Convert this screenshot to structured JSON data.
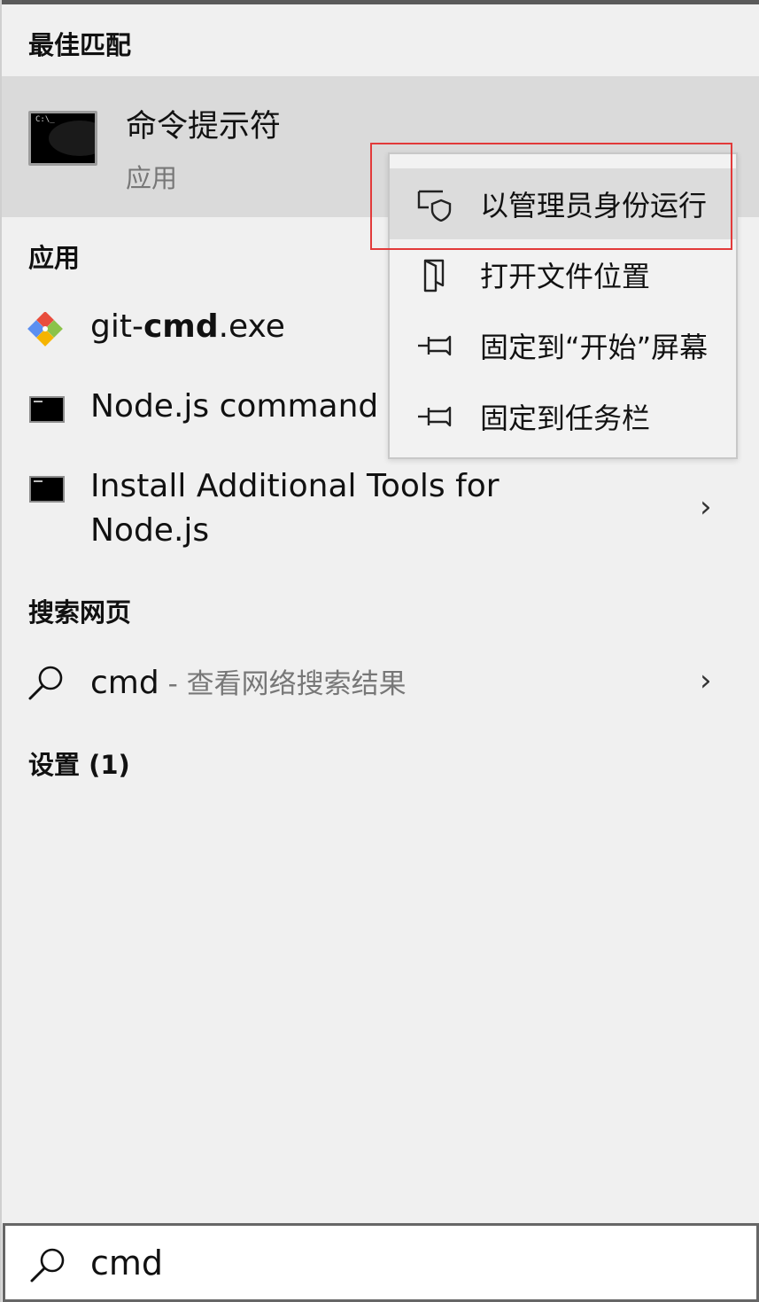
{
  "sections": {
    "best_match": "最佳匹配",
    "apps": "应用",
    "web": "搜索网页",
    "settings": "设置 (1)"
  },
  "best_match": {
    "title": "命令提示符",
    "subtitle": "应用",
    "icon": "cmd-icon"
  },
  "apps": [
    {
      "label_prefix": "git-",
      "label_bold": "cmd",
      "label_suffix": ".exe",
      "icon": "git-icon"
    },
    {
      "label": "Node.js command",
      "icon": "cmd-icon"
    },
    {
      "label_line1": "Install Additional Tools for",
      "label_line2": "Node.js",
      "icon": "cmd-icon",
      "chevron": "›"
    }
  ],
  "web_search": {
    "query": "cmd",
    "separator": " - ",
    "description": "查看网络搜索结果",
    "icon": "search-icon",
    "chevron": "›"
  },
  "context_menu": {
    "items": [
      {
        "label": "以管理员身份运行",
        "icon": "shield-icon",
        "highlighted": true
      },
      {
        "label": "打开文件位置",
        "icon": "folder-icon"
      },
      {
        "label": "固定到“开始”屏幕",
        "icon": "pin-icon"
      },
      {
        "label": "固定到任务栏",
        "icon": "pin-icon"
      }
    ]
  },
  "search_box": {
    "value": "cmd",
    "icon": "search-icon"
  },
  "colors": {
    "highlight_border": "#e23a3a",
    "row_hover": "#dadada",
    "background": "#f0f0f0"
  }
}
